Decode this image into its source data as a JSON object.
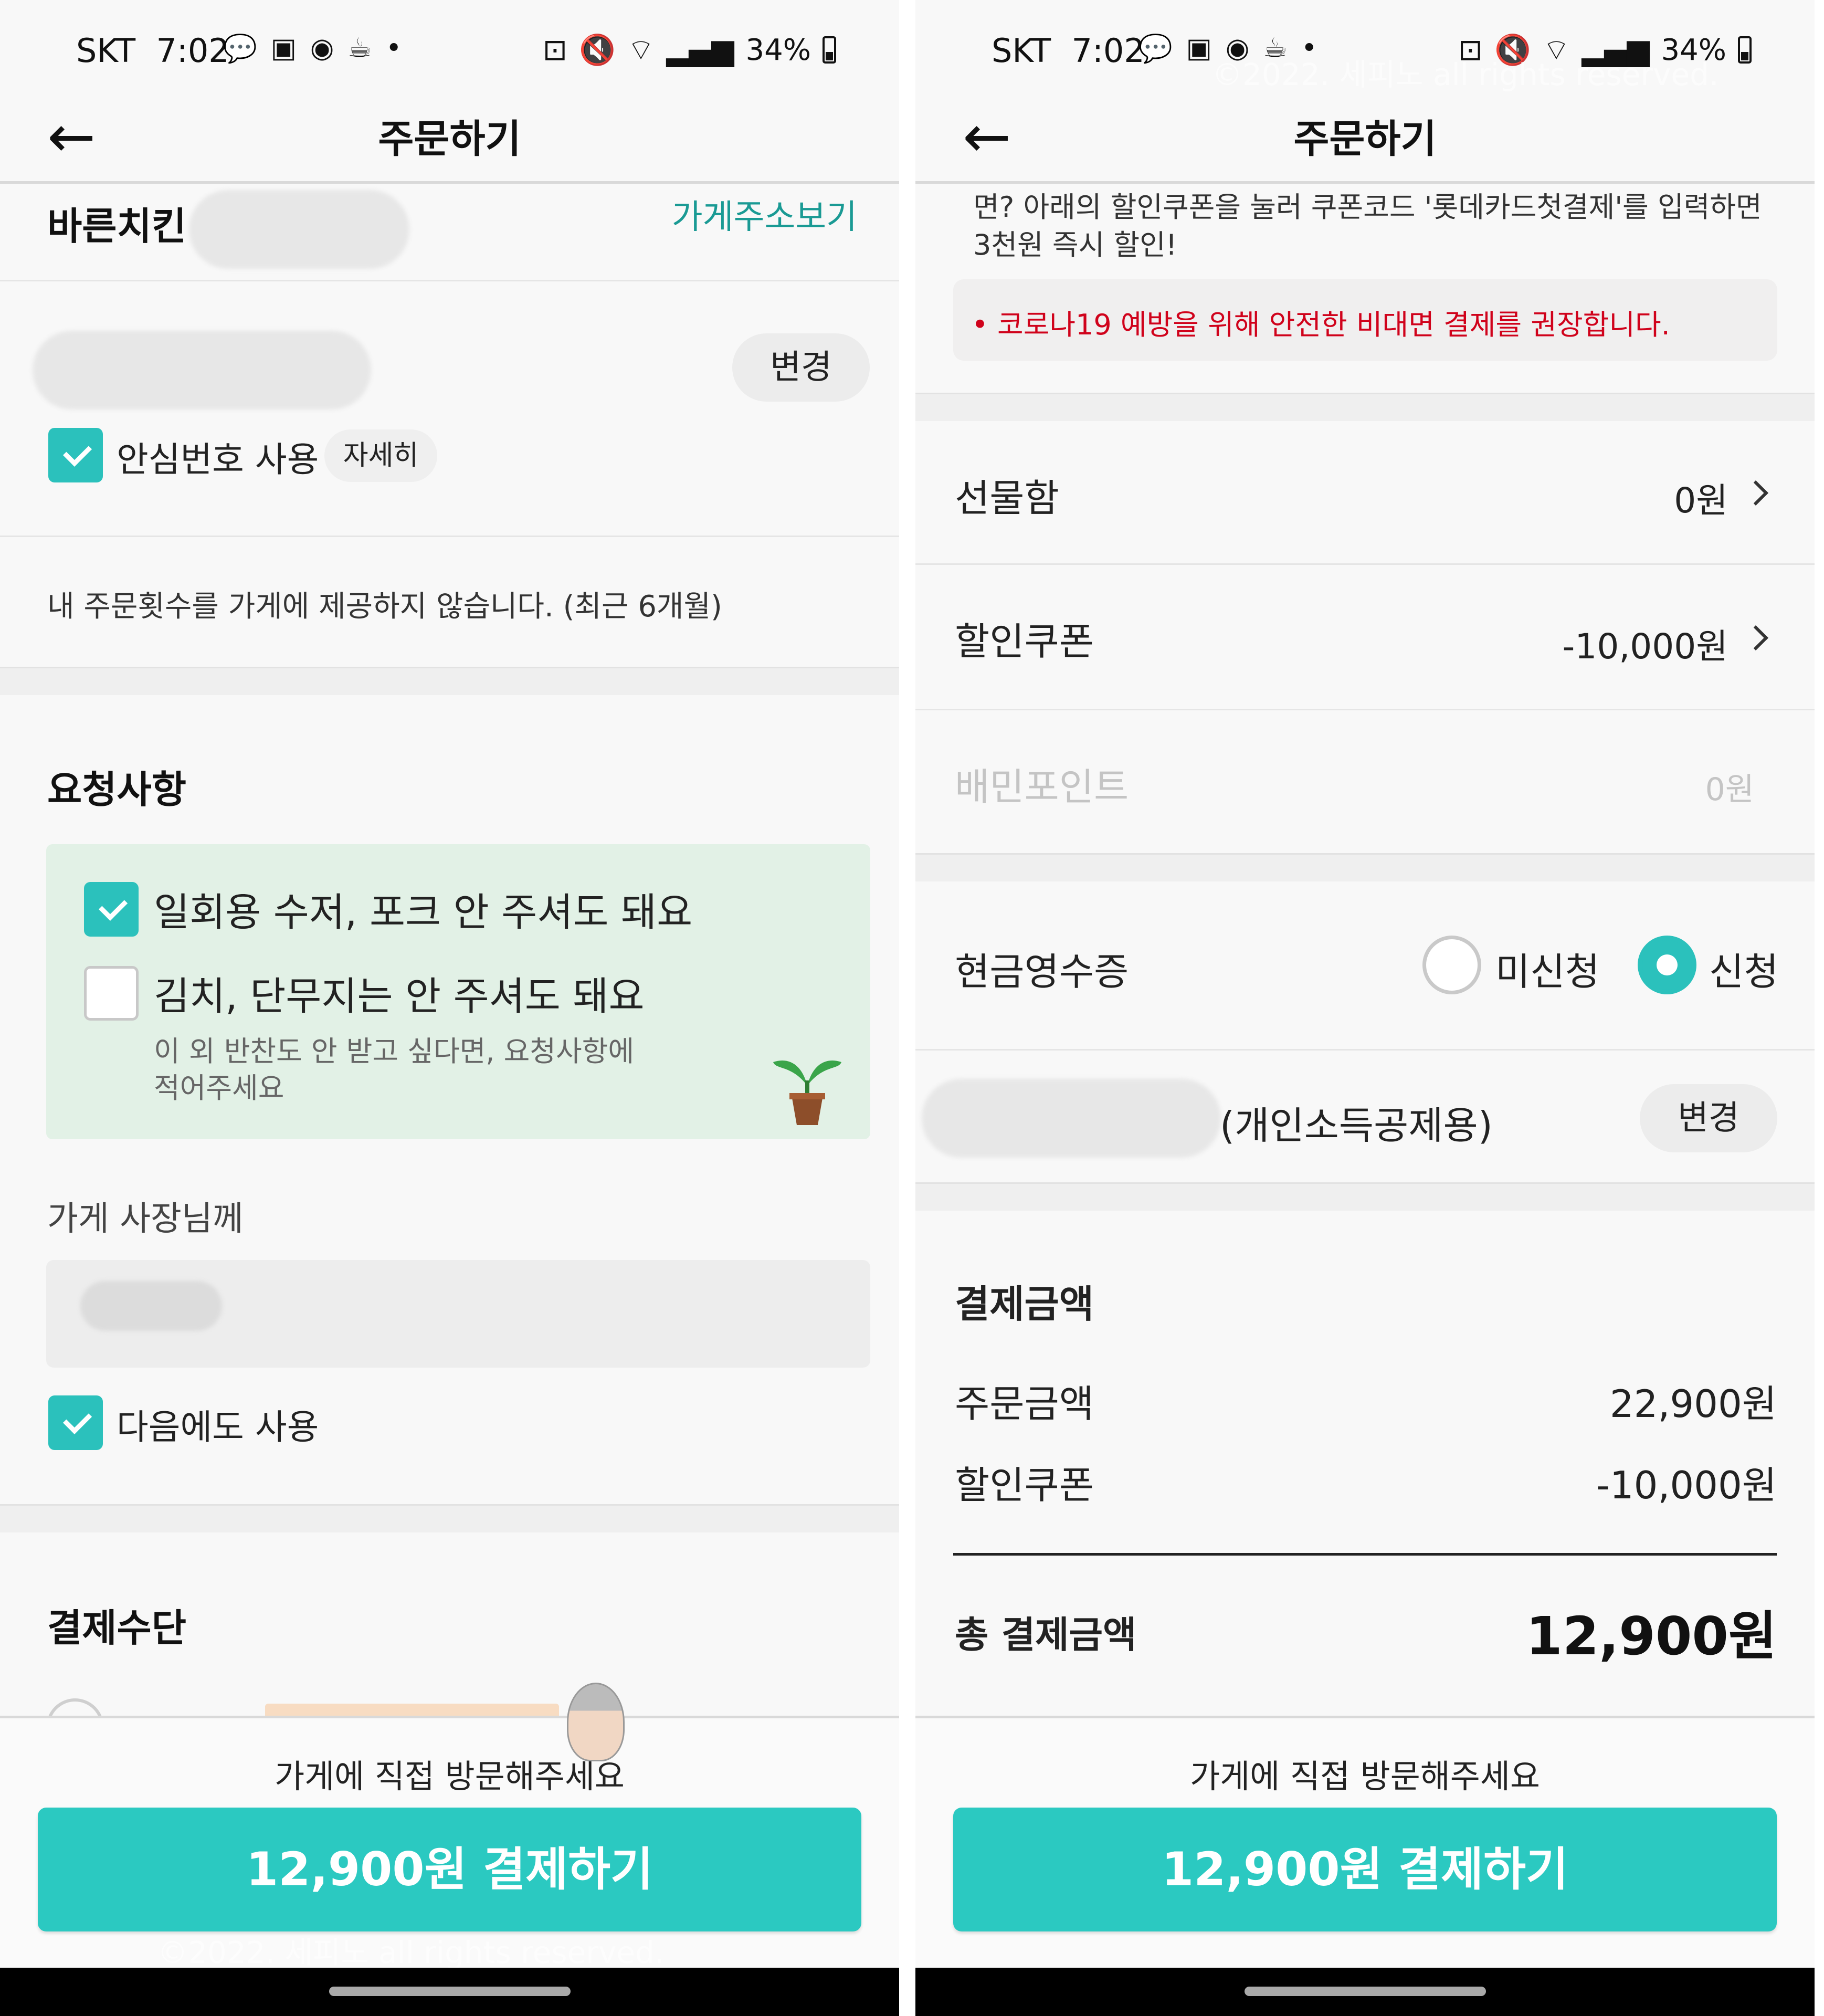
{
  "status_bar": {
    "carrier": "SKT",
    "time": "7:02",
    "battery": "34%",
    "notification_icons": [
      "talk-icon",
      "baemin-icon",
      "alarm-icon",
      "coffee-icon",
      "dot-icon"
    ],
    "system_icons": [
      "lock-icon",
      "mute-icon",
      "wifi-icon",
      "signal-icon",
      "battery-icon"
    ]
  },
  "left": {
    "header": {
      "title": "주문하기"
    },
    "store": {
      "name": "바른치킨",
      "address_link": "가게주소보기"
    },
    "phone": {
      "change_label": "변경",
      "safe_number_label": "안심번호 사용",
      "detail_label": "자세히"
    },
    "order_count_notice": "내 주문횟수를 가게에 제공하지 않습니다. (최근 6개월)",
    "request": {
      "title": "요청사항",
      "no_utensils": "일회용 수저, 포크 안 주셔도 돼요",
      "no_sides": "김치, 단무지는 안 주셔도 돼요",
      "side_hint_line1": "이 외 반찬도 안 받고 싶다면, 요청사항에",
      "side_hint_line2": "적어주세요",
      "owner_label": "가게 사장님께",
      "reuse_label": "다음에도 사용"
    },
    "payment_method_title": "결제수단",
    "visit_note": "가게에 직접 방문해주세요",
    "pay_button": "12,900원 결제하기",
    "watermark": "©2022. 세피노 all rights reserved."
  },
  "right": {
    "header": {
      "title": "주문하기"
    },
    "promo_line1": "면? 아래의 할인쿠폰을 눌러 쿠폰코드 '롯데카드첫결제'를 입력하면",
    "promo_line2": "3천원 즉시 할인!",
    "covid_notice": "• 코로나19 예방을 위해 안전한 비대면 결제를 권장합니다.",
    "gift_box": {
      "label": "선물함",
      "value": "0원"
    },
    "coupon": {
      "label": "할인쿠폰",
      "value": "-10,000원"
    },
    "points": {
      "label": "배민포인트",
      "value": "0원"
    },
    "cash_receipt": {
      "label": "현금영수증",
      "option_off": "미신청",
      "option_on": "신청",
      "selected": "신청"
    },
    "receipt_type": {
      "label": "(개인소득공제용)",
      "change_label": "변경"
    },
    "summary": {
      "title": "결제금액",
      "order_label": "주문금액",
      "order_value": "22,900원",
      "coupon_label": "할인쿠폰",
      "coupon_value": "-10,000원",
      "total_label": "총 결제금액",
      "total_value": "12,900원"
    },
    "visit_note": "가게에 직접 방문해주세요",
    "pay_button": "12,900원 결제하기",
    "watermark": "©2022. 세피노 all rights reserved."
  },
  "colors": {
    "accent": "#2bc1bc",
    "pay_button": "#2bc9c1",
    "notice_red": "#d0021b",
    "link_teal": "#1a9a94"
  }
}
